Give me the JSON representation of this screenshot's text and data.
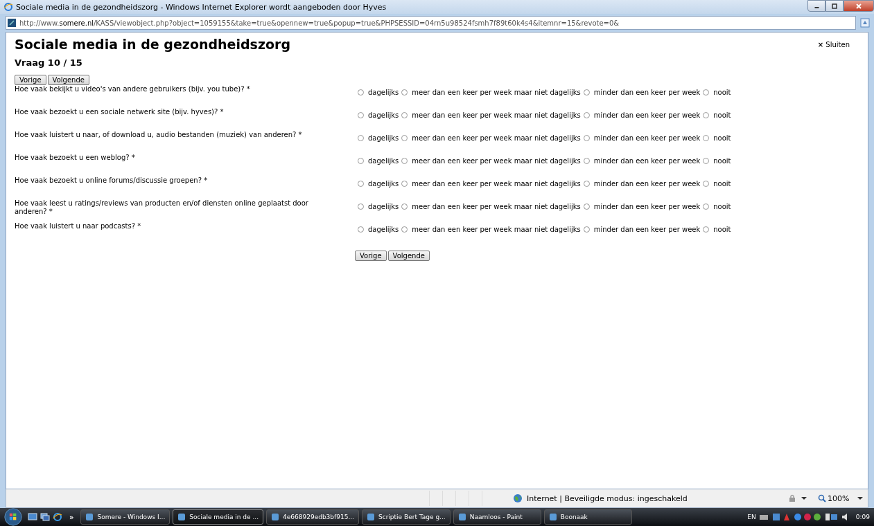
{
  "window": {
    "title": "Sociale media in de gezondheidszorg - Windows Internet Explorer wordt aangeboden door Hyves"
  },
  "address_bar": {
    "url_prefix": "http://www.",
    "url_domain": "somere.nl",
    "url_rest": "/KASS/viewobject.php?object=1059155&take=true&opennew=true&popup=true&PHPSESSID=04rn5u98524fsmh7f89t60k4s4&itemnr=15&revote=0&"
  },
  "page": {
    "title": "Sociale media in de gezondheidszorg",
    "close_link": "Sluiten",
    "close_icon": "×",
    "progress": "Vraag 10 / 15",
    "top_buttons": [
      "Vorige",
      "Volgende"
    ],
    "bottom_buttons": [
      "Vorige",
      "Volgende"
    ],
    "questions": [
      {
        "text": "Hoe vaak bekijkt u video's van andere gebruikers (bijv. you tube)? *",
        "options": [
          {
            "label": "dagelijks",
            "selected": false
          },
          {
            "label": "meer dan een keer per week maar niet dagelijks",
            "selected": false
          },
          {
            "label": "minder dan een keer per week",
            "selected": false
          },
          {
            "label": "nooit",
            "selected": false
          }
        ]
      },
      {
        "text": "Hoe vaak bezoekt u een sociale netwerk site (bijv. hyves)? *",
        "options": [
          {
            "label": "dagelijks",
            "selected": false
          },
          {
            "label": "meer dan een keer per week maar niet dagelijks",
            "selected": false
          },
          {
            "label": "minder dan een keer per week",
            "selected": false
          },
          {
            "label": "nooit",
            "selected": false
          }
        ]
      },
      {
        "text": "Hoe vaak luistert u naar, of download u, audio bestanden (muziek) van anderen? *",
        "options": [
          {
            "label": "dagelijks",
            "selected": false
          },
          {
            "label": "meer dan een keer per week maar niet dagelijks",
            "selected": false
          },
          {
            "label": "minder dan een keer per week",
            "selected": false
          },
          {
            "label": "nooit",
            "selected": false
          }
        ]
      },
      {
        "text": "Hoe vaak bezoekt u een weblog? *",
        "options": [
          {
            "label": "dagelijks",
            "selected": false
          },
          {
            "label": "meer dan een keer per week maar niet dagelijks",
            "selected": false
          },
          {
            "label": "minder dan een keer per week",
            "selected": false
          },
          {
            "label": "nooit",
            "selected": false
          }
        ]
      },
      {
        "text": "Hoe vaak bezoekt u online forums/discussie groepen? *",
        "options": [
          {
            "label": "dagelijks",
            "selected": false
          },
          {
            "label": "meer dan een keer per week maar niet dagelijks",
            "selected": false
          },
          {
            "label": "minder dan een keer per week",
            "selected": false
          },
          {
            "label": "nooit",
            "selected": false
          }
        ]
      },
      {
        "text": "Hoe vaak leest u ratings/reviews van producten en/of diensten online geplaatst door anderen? *",
        "options": [
          {
            "label": "dagelijks",
            "selected": false
          },
          {
            "label": "meer dan een keer per week maar niet dagelijks",
            "selected": false
          },
          {
            "label": "minder dan een keer per week",
            "selected": false
          },
          {
            "label": "nooit",
            "selected": false
          }
        ]
      },
      {
        "text": "Hoe vaak luistert u naar podcasts? *",
        "options": [
          {
            "label": "dagelijks",
            "selected": false
          },
          {
            "label": "meer dan een keer per week maar niet dagelijks",
            "selected": false
          },
          {
            "label": "minder dan een keer per week",
            "selected": false
          },
          {
            "label": "nooit",
            "selected": false
          }
        ]
      }
    ]
  },
  "status_bar": {
    "zone": "Internet | Beveiligde modus: ingeschakeld",
    "zoom": "100%"
  },
  "taskbar": {
    "quick_launch_more": "»",
    "items": [
      {
        "label": "Somere - Windows I...",
        "selected": false
      },
      {
        "label": "Sociale media in de ...",
        "selected": true
      },
      {
        "label": "4e668929edb3bf915...",
        "selected": false
      },
      {
        "label": "Scriptie Bert Tage g...",
        "selected": false
      },
      {
        "label": "Naamloos - Paint",
        "selected": false
      },
      {
        "label": "Boonaak",
        "selected": false
      }
    ],
    "language": "EN",
    "clock": "0:09"
  }
}
